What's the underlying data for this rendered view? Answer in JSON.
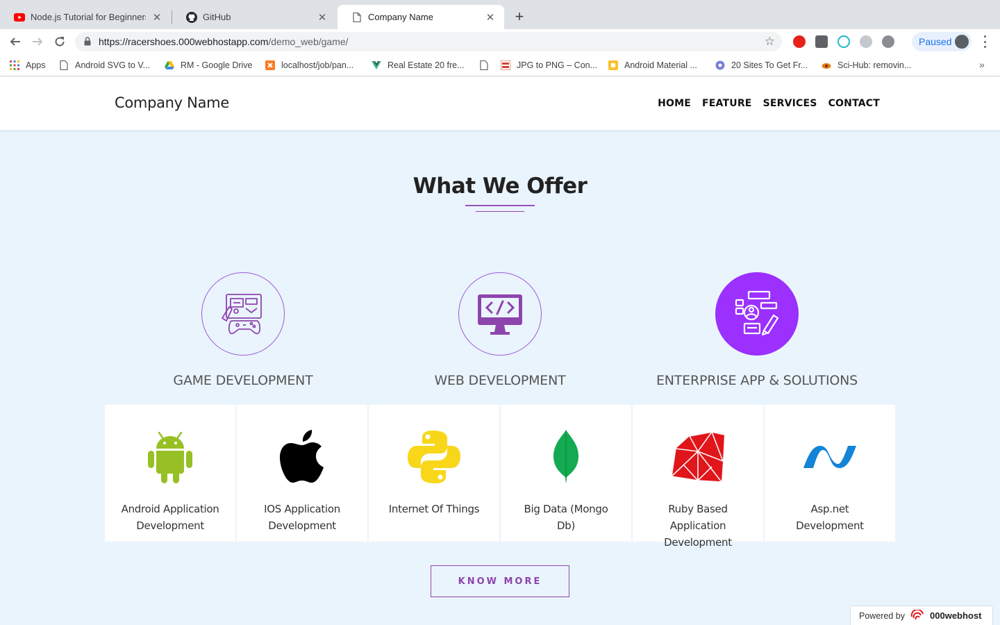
{
  "browser": {
    "tabs": [
      {
        "title": "Node.js Tutorial for Beginners:",
        "favicon": "youtube-icon",
        "active": false
      },
      {
        "title": "GitHub",
        "favicon": "github-icon",
        "active": false
      },
      {
        "title": "Company Name",
        "favicon": "page-icon",
        "active": true
      }
    ],
    "url_host": "https://racershoes.000webhostapp.com",
    "url_path": "/demo_web/game/",
    "profile_label": "Paused",
    "bookmarks": [
      {
        "label": "Apps",
        "icon": "apps-grid-icon"
      },
      {
        "label": "Android SVG to V...",
        "icon": "page-icon"
      },
      {
        "label": "RM - Google Drive",
        "icon": "google-drive-icon"
      },
      {
        "label": "localhost/job/pan...",
        "icon": "xampp-icon"
      },
      {
        "label": "Real Estate 20 fre...",
        "icon": "vue-icon"
      },
      {
        "label": "",
        "icon": "page-icon"
      },
      {
        "label": "JPG to PNG – Con...",
        "icon": "jpg-png-icon"
      },
      {
        "label": "Android Material ...",
        "icon": "material-icon"
      },
      {
        "label": "20 Sites To Get Fr...",
        "icon": "globe-icon"
      },
      {
        "label": "Sci-Hub: removin...",
        "icon": "scihub-icon"
      }
    ]
  },
  "header": {
    "brand": "Company Name",
    "nav": [
      "HOME",
      "FEATURE",
      "SERVICES",
      "CONTACT"
    ]
  },
  "offer": {
    "title": "What We Offer",
    "items": [
      {
        "label": "GAME DEVELOPMENT",
        "icon": "game-development-icon"
      },
      {
        "label": "WEB DEVELOPMENT",
        "icon": "web-development-icon"
      },
      {
        "label": "ENTERPRISE APP & SOLUTIONS",
        "icon": "enterprise-solutions-icon"
      }
    ]
  },
  "technologies": [
    {
      "label": "Android Application Development",
      "icon": "android-icon"
    },
    {
      "label": "IOS Application Development",
      "icon": "apple-icon"
    },
    {
      "label": "Internet Of Things",
      "icon": "python-icon"
    },
    {
      "label": "Big Data (Mongo Db)",
      "icon": "mongodb-icon"
    },
    {
      "label": "Ruby Based Application Development",
      "icon": "ruby-icon"
    },
    {
      "label": "Asp.net Development",
      "icon": "dotnet-icon"
    }
  ],
  "cta": {
    "label": "KNOW MORE"
  },
  "footer_badge": {
    "prefix": "Powered by",
    "brand": "000webhost"
  },
  "colors": {
    "accent": "#8e44ad",
    "page_bg": "#eaf4fd",
    "android": "#97c024",
    "mongo": "#13aa52",
    "ruby": "#e0161b",
    "dotnet": "#1384d6",
    "python": "#f8d71b"
  }
}
